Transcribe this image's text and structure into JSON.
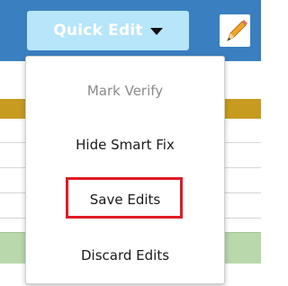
{
  "toolbar": {
    "quick_edit_label": "Quick Edit",
    "pencil_icon": "pencil-icon"
  },
  "menu": {
    "items": [
      {
        "label": "Mark Verify",
        "enabled": false
      },
      {
        "label": "Hide Smart Fix",
        "enabled": true
      },
      {
        "label": "Save Edits",
        "enabled": true,
        "highlighted": true
      },
      {
        "label": "Discard Edits",
        "enabled": true
      }
    ]
  },
  "colors": {
    "toolbar_bg": "#3a7fc0",
    "button_bg": "#b7e5f9",
    "highlight": "#e01b24",
    "gold_row": "#c79b20",
    "green_row": "#b9d8ab"
  }
}
